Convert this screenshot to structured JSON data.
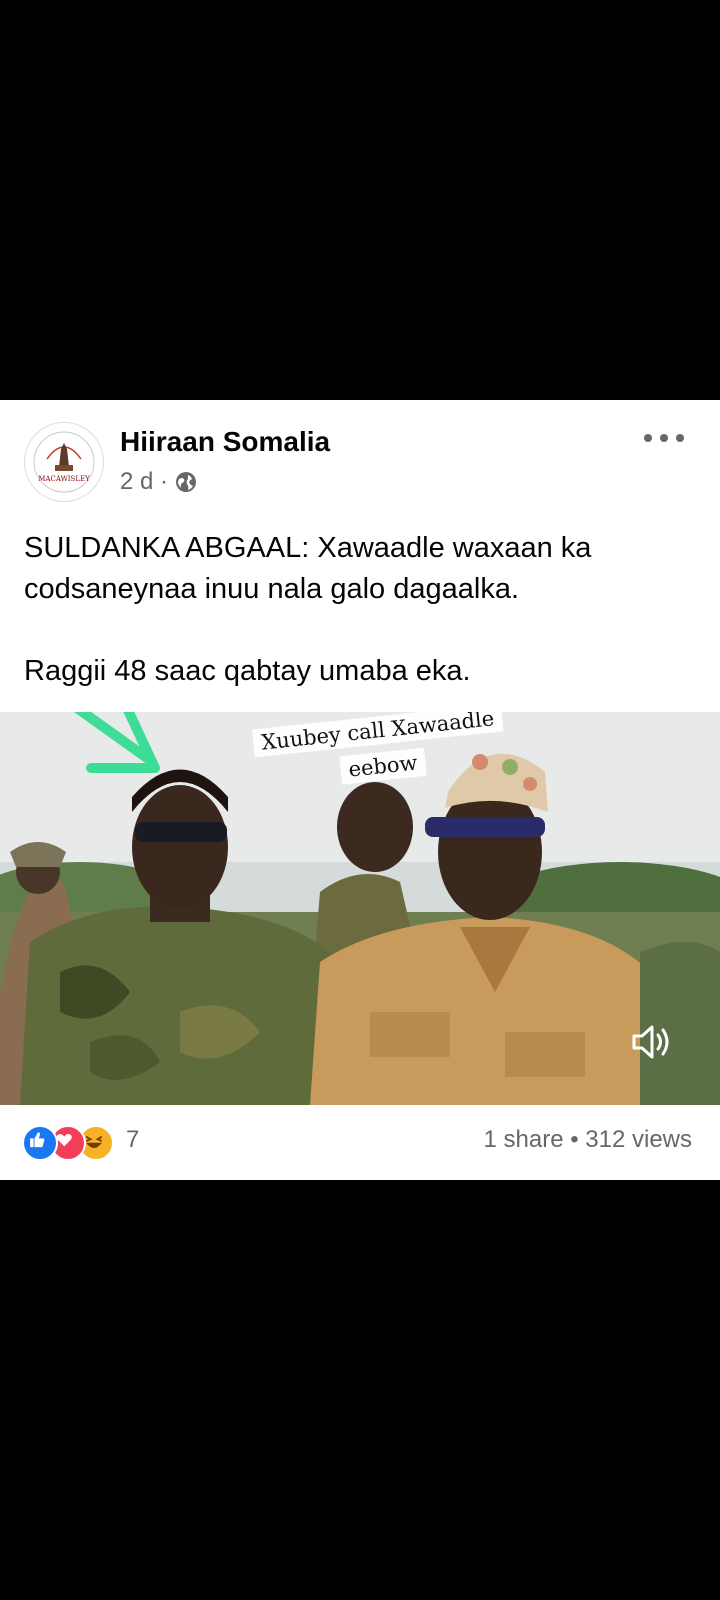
{
  "post": {
    "author": "Hiiraan Somalia",
    "avatar_text": "MACAWISLEY",
    "time": "2 d ·",
    "privacy_icon": "globe-icon",
    "more_icon": "more-options-icon",
    "text_line1": "SULDANKA ABGAAL: Xawaadle waxaan ka codsaneynaa inuu nala galo dagaalka.",
    "text_line2": "Raggii 48 saac qabtay umaba eka."
  },
  "video": {
    "caption_line1": "Xuubey  call Xawaadle",
    "caption_line2": "eebow",
    "volume_icon": "volume-icon",
    "arrow_color": "#3ddc97"
  },
  "footer": {
    "reaction_icons": [
      "like-icon",
      "love-icon",
      "haha-icon"
    ],
    "reaction_count": "7",
    "stats": "1 share • 312 views"
  },
  "colors": {
    "like": "#1877f2",
    "love": "#f33e58",
    "haha": "#f7b125"
  }
}
